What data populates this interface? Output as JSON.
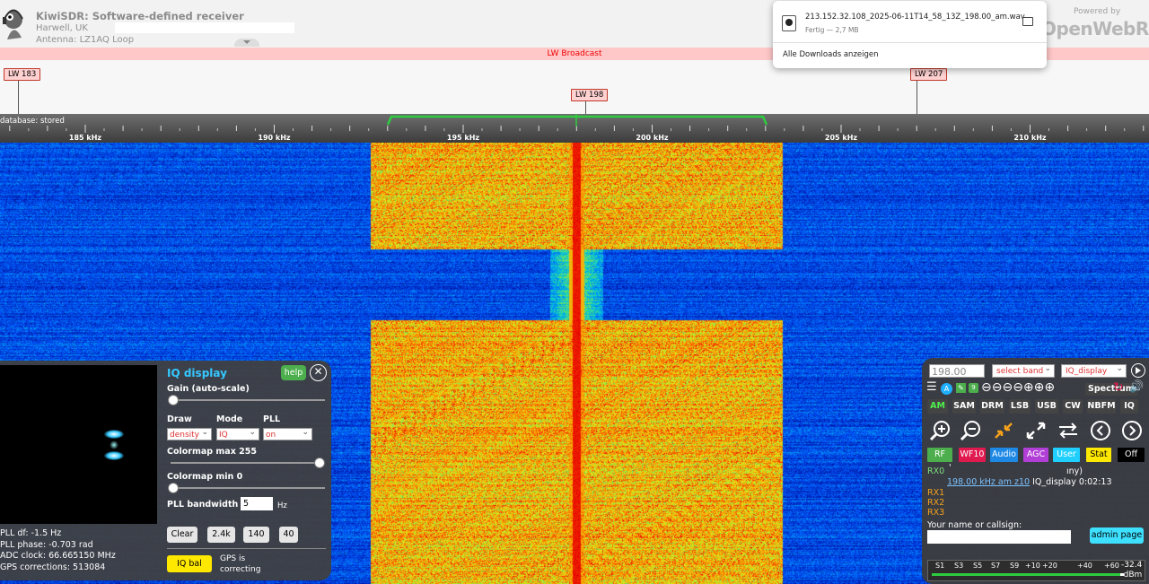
{
  "header": {
    "title": "KiwiSDR: Software-defined receiver",
    "location": "Harwell, UK",
    "antenna": "Antenna: LZ1AQ Loop",
    "powered_by": "Powered by",
    "brand": "OpenWebRX"
  },
  "band_bar": {
    "label": "LW Broadcast"
  },
  "stations": [
    {
      "label": "LW 183"
    },
    {
      "label": "LW 198"
    },
    {
      "label": "LW 207"
    }
  ],
  "scale": {
    "database_label": "database: stored",
    "ticks": [
      "185 kHz",
      "190 kHz",
      "195 kHz",
      "200 kHz",
      "205 kHz",
      "210 kHz"
    ]
  },
  "download_popup": {
    "filename": "213.152.32.108_2025-06-11T14_58_13Z_198.00_am.wav",
    "status": "Fertig — 2,7 MB",
    "show_all": "Alle Downloads anzeigen"
  },
  "iq_panel": {
    "title": "IQ display",
    "help": "help",
    "gain_label": "Gain (auto-scale)",
    "draw_label": "Draw",
    "mode_label": "Mode",
    "pll_label": "PLL",
    "draw_value": "density",
    "mode_value": "IQ",
    "pll_value": "on",
    "cmap_max_label": "Colormap max 255",
    "cmap_min_label": "Colormap min 0",
    "pll_bw_label": "PLL bandwidth",
    "pll_bw_value": "5",
    "hz": "Hz",
    "buttons": [
      "Clear",
      "2.4k",
      "140",
      "40"
    ],
    "iq_bal": "IQ bal",
    "gps_line1": "GPS is",
    "gps_line2": "correcting",
    "stats": [
      "PLL df: -1.5 Hz",
      "PLL phase: -0.703 rad",
      "ADC clock: 66.665150 MHz",
      "GPS corrections: 513084"
    ],
    "gain_level": 0.0,
    "cmap_max_level": 1.0,
    "cmap_min_level": 0.0
  },
  "control_panel": {
    "frequency": "198.00",
    "band_select": "select band",
    "ext_select": "IQ_display",
    "spectrum": "Spectrum",
    "modes": [
      "AM",
      "SAM",
      "DRM",
      "LSB",
      "USB",
      "CW",
      "NBFM",
      "IQ"
    ],
    "tabs": [
      {
        "label": "RF",
        "color": "#4cae4c",
        "fg": "#fff"
      },
      {
        "label": "WF10",
        "color": "#e0194f",
        "fg": "#fff"
      },
      {
        "label": "Audio",
        "color": "#1e88e5",
        "fg": "#fff"
      },
      {
        "label": "AGC",
        "color": "#b13ed6",
        "fg": "#fff"
      },
      {
        "label": "User",
        "color": "#1fd0ff",
        "fg": "#fff"
      },
      {
        "label": "Stat",
        "color": "#ffe800",
        "fg": "#000"
      },
      {
        "label": "Off",
        "color": "#000000",
        "fg": "#fff"
      }
    ],
    "rx_labels": [
      "RX0",
      "RX1",
      "RX2",
      "RX3"
    ],
    "rx0_suffix": "ıny)",
    "rx0_link": "198.00 kHz am z10",
    "rx0_info": " IQ_display 0:02:13",
    "callsign_label": "Your name or callsign:",
    "admin": "admin page",
    "smeter_labels": [
      "S1",
      "S3",
      "S5",
      "S7",
      "S9",
      "+10",
      "+20",
      "+40",
      "+60"
    ],
    "dbm_value": "-32.4",
    "dbm_unit": "dBm"
  }
}
